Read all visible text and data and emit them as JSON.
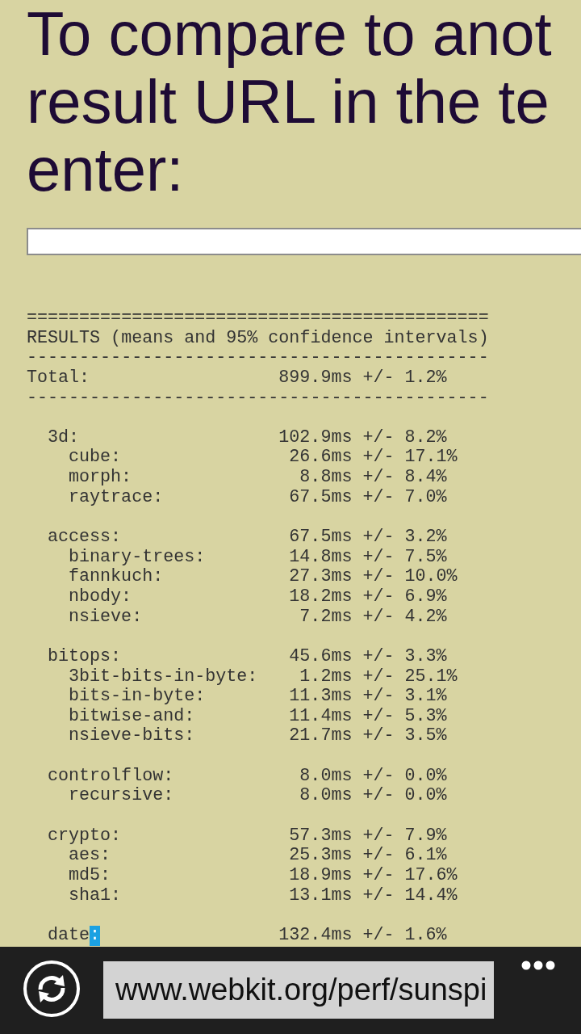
{
  "intro": {
    "lines": [
      "To compare to anot",
      "result URL in the te",
      "enter:"
    ]
  },
  "compare_field": {
    "kind": "text"
  },
  "results": {
    "rule_top": "============================================",
    "title": "RESULTS (means and 95% confidence intervals)",
    "rule": "--------------------------------------------",
    "total": {
      "name": "Total:",
      "time": "899.9ms",
      "error": "+/- 1.2%"
    },
    "rule_bottom": "--------------------------------------------",
    "groups": [
      {
        "name": "3d:",
        "time": "102.9ms",
        "error": "+/- 8.2%",
        "end_selected": false,
        "children": [
          {
            "name": "cube:",
            "time": "26.6ms",
            "error": "+/- 17.1%"
          },
          {
            "name": "morph:",
            "time": "8.8ms",
            "error": "+/- 8.4%"
          },
          {
            "name": "raytrace:",
            "time": "67.5ms",
            "error": "+/- 7.0%"
          }
        ]
      },
      {
        "name": "access:",
        "time": "67.5ms",
        "error": "+/- 3.2%",
        "end_selected": false,
        "children": [
          {
            "name": "binary-trees:",
            "time": "14.8ms",
            "error": "+/- 7.5%"
          },
          {
            "name": "fannkuch:",
            "time": "27.3ms",
            "error": "+/- 10.0%"
          },
          {
            "name": "nbody:",
            "time": "18.2ms",
            "error": "+/- 6.9%"
          },
          {
            "name": "nsieve:",
            "time": "7.2ms",
            "error": "+/- 4.2%"
          }
        ]
      },
      {
        "name": "bitops:",
        "time": "45.6ms",
        "error": "+/- 3.3%",
        "end_selected": false,
        "children": [
          {
            "name": "3bit-bits-in-byte:",
            "time": "1.2ms",
            "error": "+/- 25.1%"
          },
          {
            "name": "bits-in-byte:",
            "time": "11.3ms",
            "error": "+/- 3.1%"
          },
          {
            "name": "bitwise-and:",
            "time": "11.4ms",
            "error": "+/- 5.3%"
          },
          {
            "name": "nsieve-bits:",
            "time": "21.7ms",
            "error": "+/- 3.5%"
          }
        ]
      },
      {
        "name": "controlflow:",
        "time": "8.0ms",
        "error": "+/- 0.0%",
        "end_selected": false,
        "children": [
          {
            "name": "recursive:",
            "time": "8.0ms",
            "error": "+/- 0.0%"
          }
        ]
      },
      {
        "name": "crypto:",
        "time": "57.3ms",
        "error": "+/- 7.9%",
        "end_selected": false,
        "children": [
          {
            "name": "aes:",
            "time": "25.3ms",
            "error": "+/- 6.1%"
          },
          {
            "name": "md5:",
            "time": "18.9ms",
            "error": "+/- 17.6%"
          },
          {
            "name": "sha1:",
            "time": "13.1ms",
            "error": "+/- 14.4%"
          }
        ]
      },
      {
        "name": "date:",
        "time": "132.4ms",
        "error": "+/- 1.6%",
        "end_selected": true
      }
    ]
  },
  "address_bar": {
    "url": "www.webkit.org/perf/sunspi"
  }
}
